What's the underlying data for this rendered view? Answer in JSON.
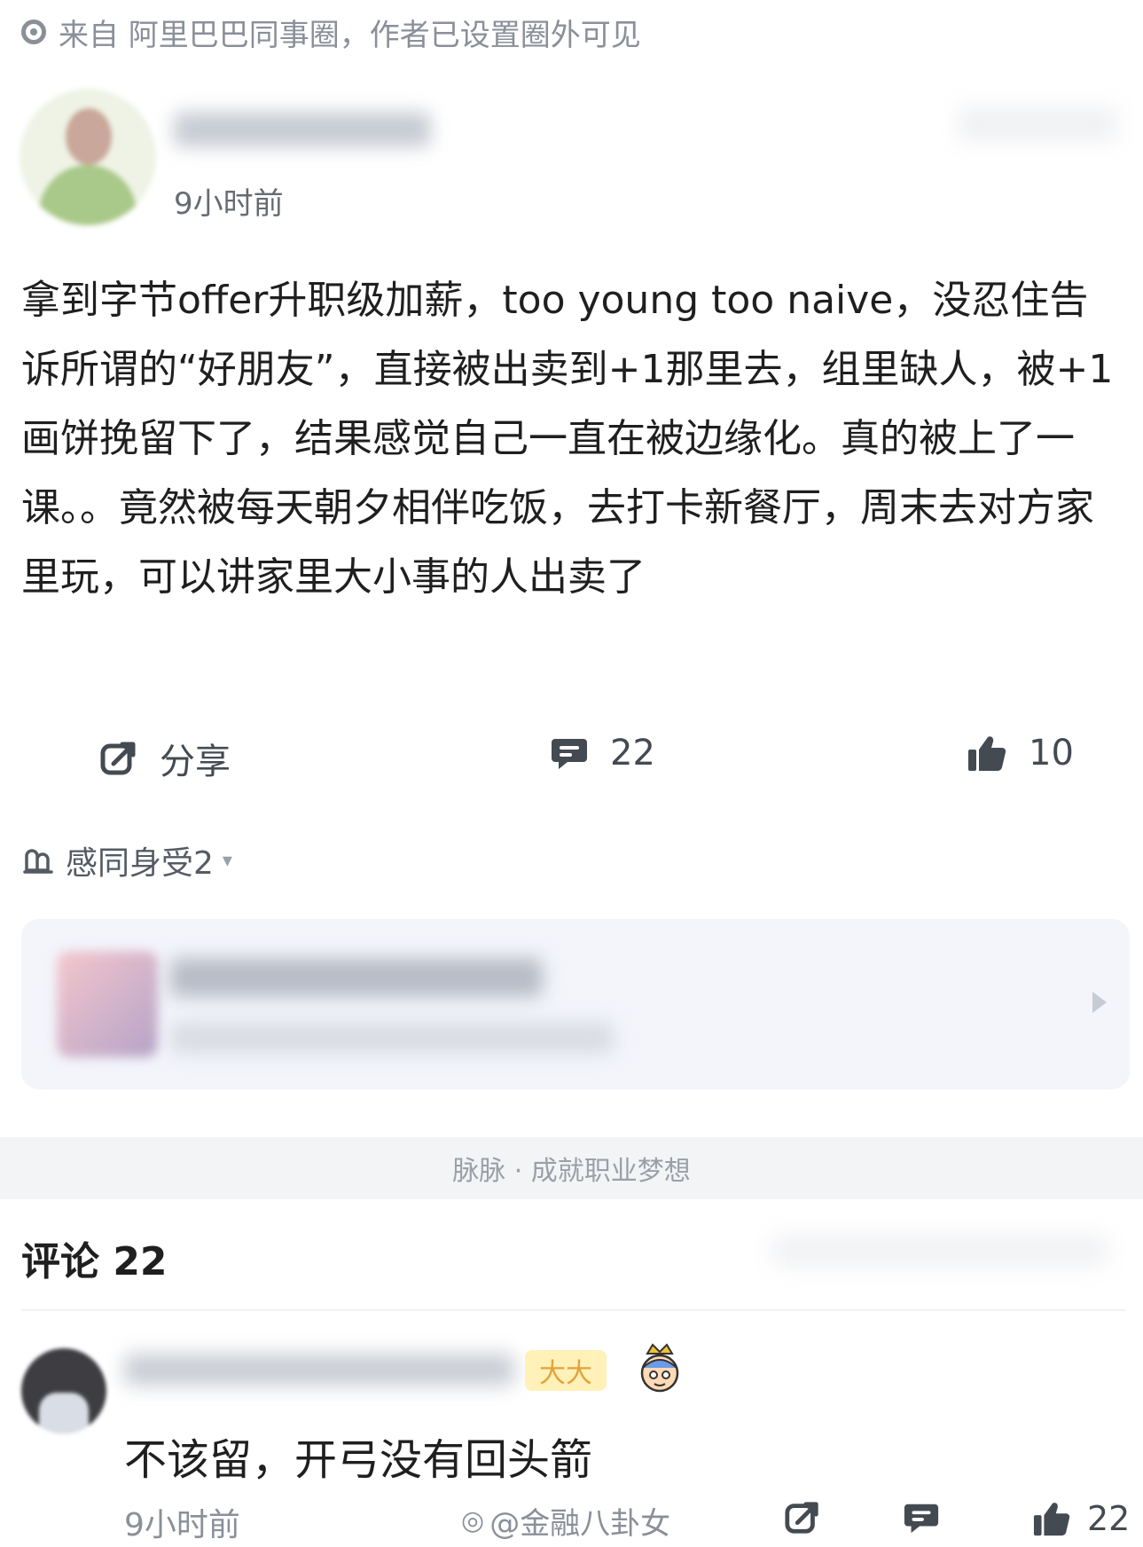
{
  "source": {
    "icon": "circle-dot-icon",
    "text": "来自 阿里巴巴同事圈，作者已设置圈外可见"
  },
  "post": {
    "time": "9小时前",
    "body": "拿到字节offer升职级加薪，too young too naive，没忍住告诉所谓的“好朋友”，直接被出卖到+1那里去，组里缺人，被+1画饼挽留下了，结果感觉自己一直在被边缘化。真的被上了一课。。竟然被每天朝夕相伴吃饭，去打卡新餐厅，周末去对方家里玩，可以讲家里大小事的人出卖了"
  },
  "actions": {
    "share_label": "分享",
    "comment_count": "22",
    "like_count": "10"
  },
  "reaction": {
    "label": "感同身受2",
    "caret": "▾"
  },
  "footer_banner": "脉脉 · 成就职业梦想",
  "comments": {
    "title": "评论 22",
    "items": [
      {
        "badge": "大大",
        "text": "不该留，开弓没有回头箭",
        "time": "9小时前",
        "like_count": "22"
      }
    ]
  },
  "watermark": "@金融八卦女",
  "colors": {
    "text_primary": "#1f1f1f",
    "text_secondary": "#8a8f99",
    "card_bg": "#f3f5fb",
    "badge_bg": "#fff1b8",
    "badge_text": "#e2a23c"
  }
}
